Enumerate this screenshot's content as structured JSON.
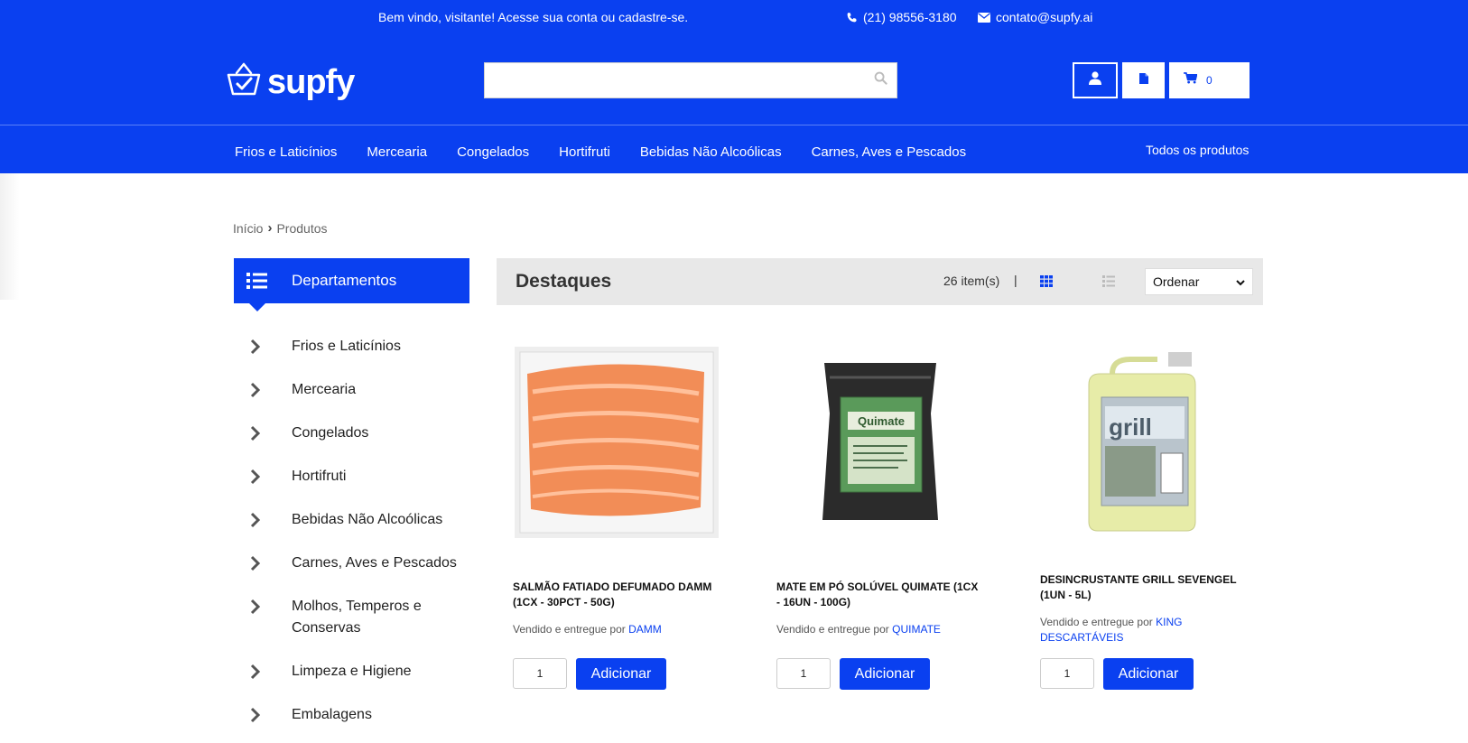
{
  "topbar": {
    "welcome": "Bem vindo, visitante! Acesse sua conta ou cadastre-se.",
    "phone": "(21) 98556-3180",
    "email": "contato@supfy.ai"
  },
  "header": {
    "logo_text": "supfy",
    "search": {
      "value": "",
      "placeholder": ""
    },
    "cart_count": "0"
  },
  "nav": {
    "items": [
      "Frios e Laticínios",
      "Mercearia",
      "Congelados",
      "Hortifruti",
      "Bebidas Não Alcoólicas",
      "Carnes, Aves e Pescados"
    ],
    "all_products": "Todos os produtos"
  },
  "breadcrumb": {
    "home": "Início",
    "separator": "›",
    "current": "Produtos"
  },
  "sidebar": {
    "title": "Departamentos",
    "items": [
      "Frios e Laticínios",
      "Mercearia",
      "Congelados",
      "Hortifruti",
      "Bebidas Não Alcoólicas",
      "Carnes, Aves e Pescados",
      "Molhos, Temperos e Conservas",
      "Limpeza e Higiene",
      "Embalagens"
    ]
  },
  "toolbar": {
    "title": "Destaques",
    "count": "26 item(s)",
    "separator": "|",
    "sort_label": "Ordenar"
  },
  "products": [
    {
      "name": "SALMÃO FATIADO DEFUMADO DAMM (1CX - 30PCT - 50G)",
      "vendor_prefix": "Vendido e entregue por",
      "vendor": "DAMM",
      "qty": "1",
      "add_label": "Adicionar"
    },
    {
      "name": "MATE EM PÓ SOLÚVEL QUIMATE (1CX - 16UN - 100G)",
      "vendor_prefix": "Vendido e entregue por",
      "vendor": "QUIMATE",
      "qty": "1",
      "add_label": "Adicionar"
    },
    {
      "name": "DESINCRUSTANTE GRILL SEVENGEL (1UN - 5L)",
      "vendor_prefix": "Vendido e entregue por",
      "vendor": "KING DESCARTÁVEIS",
      "qty": "1",
      "add_label": "Adicionar"
    }
  ],
  "colors": {
    "brand": "#0a40f0",
    "toolbar_bg": "#e8e8e8"
  },
  "icons": [
    "phone-icon",
    "envelope-icon",
    "basket-logo-icon",
    "search-icon",
    "user-icon",
    "document-icon",
    "cart-icon",
    "list-icon",
    "chevron-right-icon",
    "grid-view-icon",
    "list-view-icon"
  ]
}
